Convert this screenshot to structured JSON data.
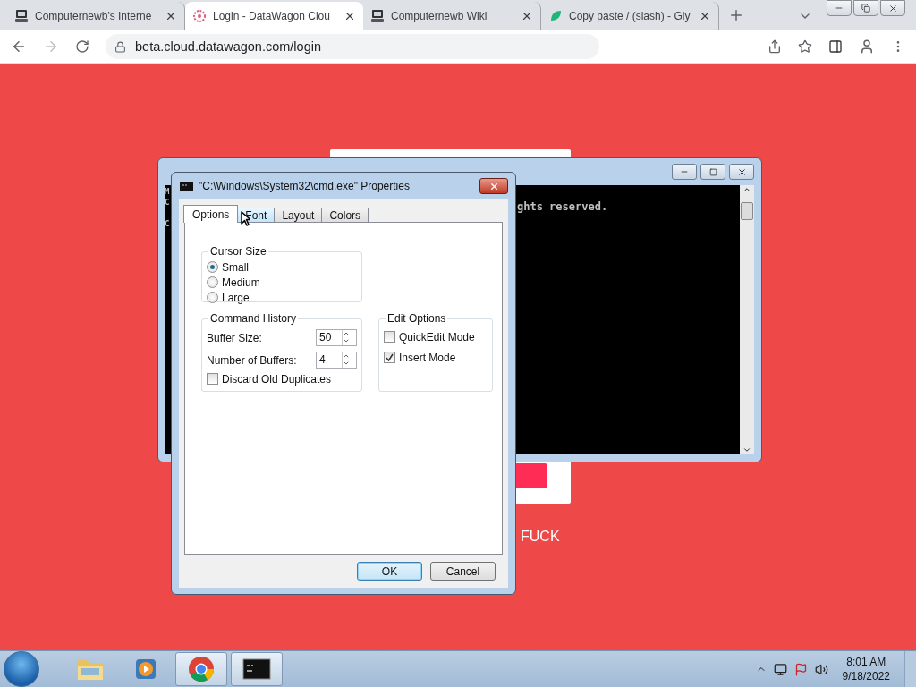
{
  "browser": {
    "tabs": [
      {
        "label": "Computernewb's Interne",
        "kind": "computer",
        "selected": false
      },
      {
        "label": "Login - DataWagon Clou",
        "kind": "flower",
        "selected": true
      },
      {
        "label": "Computernewb Wiki",
        "kind": "computer",
        "selected": false
      },
      {
        "label": "Copy paste / (slash) - Gly",
        "kind": "leaf",
        "selected": false
      }
    ],
    "address": "beta.cloud.datawagon.com/login"
  },
  "page": {
    "footer_text": "FUCK"
  },
  "console": {
    "left_column": [
      "M",
      "C",
      "C"
    ],
    "right_text": "ghts reserved."
  },
  "dialog": {
    "title": "\"C:\\Windows\\System32\\cmd.exe\" Properties",
    "tabs": [
      {
        "label": "Options",
        "selected": true,
        "hovered": false
      },
      {
        "label": "Font",
        "selected": false,
        "hovered": true
      },
      {
        "label": "Layout",
        "selected": false,
        "hovered": false
      },
      {
        "label": "Colors",
        "selected": false,
        "hovered": false
      }
    ],
    "cursor_size": {
      "title": "Cursor Size",
      "options": [
        {
          "label": "Small",
          "selected": true
        },
        {
          "label": "Medium",
          "selected": false
        },
        {
          "label": "Large",
          "selected": false
        }
      ]
    },
    "command_history": {
      "title": "Command History",
      "fields": [
        {
          "label": "Buffer Size:",
          "value": "50"
        },
        {
          "label": "Number of Buffers:",
          "value": "4"
        }
      ],
      "discard": {
        "label": "Discard Old Duplicates",
        "checked": false
      }
    },
    "edit_options": {
      "title": "Edit Options",
      "options": [
        {
          "label": "QuickEdit Mode",
          "checked": false
        },
        {
          "label": "Insert Mode",
          "checked": true
        }
      ]
    },
    "buttons": [
      {
        "label": "OK",
        "kind": "default"
      },
      {
        "label": "Cancel",
        "kind": "normal"
      }
    ]
  },
  "taskbar": {
    "apps": [
      {
        "kind": "explorer",
        "active": false
      },
      {
        "kind": "media",
        "active": false
      },
      {
        "kind": "chrome",
        "active": true
      },
      {
        "kind": "cmd",
        "active": true
      }
    ],
    "time": "8:01 AM",
    "date": "9/18/2022"
  }
}
